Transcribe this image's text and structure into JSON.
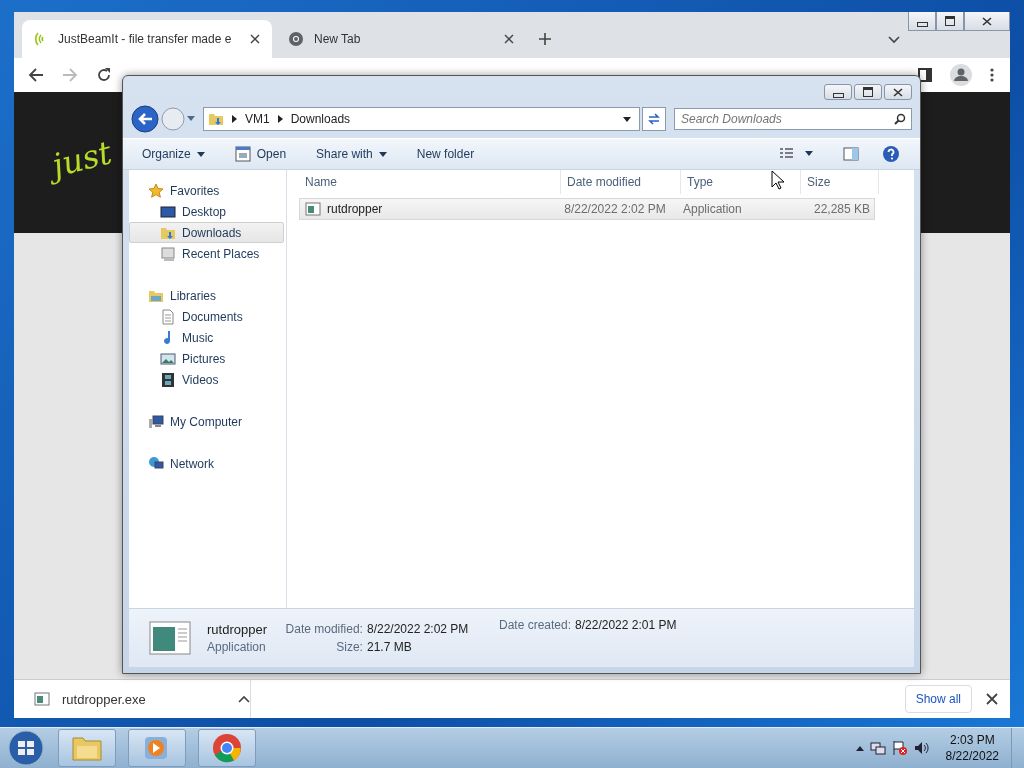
{
  "browser": {
    "tabs": [
      {
        "title": "JustBeamIt - file transfer made e",
        "kind": "site",
        "selected": true
      },
      {
        "title": "New Tab",
        "kind": "newtab",
        "selected": false
      }
    ],
    "page": {
      "logo_text": "just"
    },
    "download_bar": {
      "file": "rutdropper.exe",
      "button": "Show all"
    }
  },
  "explorer": {
    "address": {
      "crumbs": [
        "VM1",
        "Downloads"
      ]
    },
    "search": {
      "placeholder": "Search Downloads"
    },
    "toolbar": [
      {
        "label": "Organize",
        "dropdown": true,
        "kind": "menu"
      },
      {
        "label": "Open",
        "dropdown": false,
        "kind": "open"
      },
      {
        "label": "Share with",
        "dropdown": true,
        "kind": "menu"
      },
      {
        "label": "New folder",
        "dropdown": false,
        "kind": "menu"
      }
    ],
    "nav": [
      {
        "label": "Favorites",
        "selected": false,
        "children": [
          {
            "label": "Desktop",
            "selected": false
          },
          {
            "label": "Downloads",
            "selected": true
          },
          {
            "label": "Recent Places",
            "selected": false
          }
        ]
      },
      {
        "label": "Libraries",
        "selected": false,
        "children": [
          {
            "label": "Documents",
            "selected": false
          },
          {
            "label": "Music",
            "selected": false
          },
          {
            "label": "Pictures",
            "selected": false
          },
          {
            "label": "Videos",
            "selected": false
          }
        ]
      },
      {
        "label": "My Computer",
        "selected": false
      },
      {
        "label": "Network",
        "selected": false
      }
    ],
    "columns": [
      "Name",
      "Date modified",
      "Type",
      "Size"
    ],
    "rows": [
      {
        "name": "rutdropper",
        "date_modified": "8/22/2022 2:02 PM",
        "type": "Application",
        "size": "22,285 KB",
        "highlighted": true
      }
    ],
    "details": {
      "name": "rutdropper",
      "type": "Application",
      "fields": [
        {
          "label": "Date modified:",
          "value": "8/22/2022 2:02 PM"
        },
        {
          "label": "Size:",
          "value": "21.7 MB"
        },
        {
          "label": "Date created:",
          "value": "8/22/2022 2:01 PM"
        }
      ]
    }
  },
  "taskbar": {
    "time": "2:03 PM",
    "date": "8/22/2022"
  }
}
